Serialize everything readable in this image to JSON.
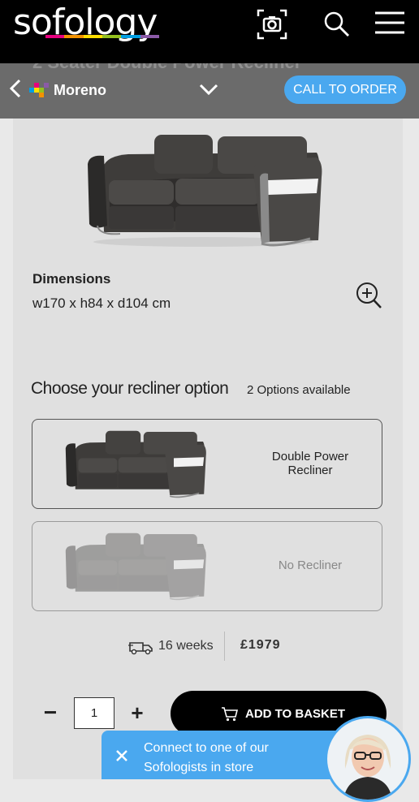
{
  "header": {
    "logo_text": "sofology",
    "logo_colors": [
      "#e6007e",
      "#f39200",
      "#ffde00",
      "#95c11f",
      "#009fe3",
      "#8b5aa8"
    ],
    "icons": [
      "camera-search-icon",
      "search-icon",
      "menu-icon"
    ]
  },
  "subheader": {
    "ghost_title": "2 Seater Double Power Recliner",
    "brand_name": "Moreno",
    "call_button": "CALL TO ORDER"
  },
  "product": {
    "dimensions_title": "Dimensions",
    "dimensions_value": "w170 x h84 x d104 cm"
  },
  "recliner": {
    "heading": "Choose your recliner option",
    "options_count": "2 Options available",
    "options": [
      {
        "label": "Double Power Recliner",
        "selected": true
      },
      {
        "label": "No Recliner",
        "selected": false
      }
    ]
  },
  "delivery": {
    "lead_time": "16 weeks",
    "price": "£1979"
  },
  "cart": {
    "quantity": "1",
    "add_button": "ADD TO BASKET"
  },
  "chat": {
    "text_line1": "Connect to one of our",
    "text_line2": "Sofologists in store"
  }
}
